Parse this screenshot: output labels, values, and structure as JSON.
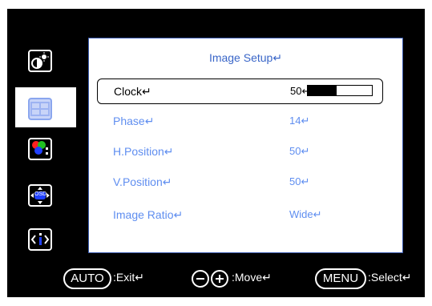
{
  "panel": {
    "title": "Image Setup↵"
  },
  "rows": [
    {
      "label": "Clock↵",
      "value": "50↵",
      "bar_fraction": 0.45
    },
    {
      "label": "Phase↵",
      "value": "14↵"
    },
    {
      "label": "H.Position↵",
      "value": "50↵"
    },
    {
      "label": "V.Position↵",
      "value": "50↵"
    },
    {
      "label": "Image Ratio↵",
      "value": "Wide↵"
    }
  ],
  "sidebar": {
    "items": [
      {
        "icon": "brightness-contrast-icon"
      },
      {
        "icon": "image-setup-icon",
        "active": true
      },
      {
        "icon": "color-icon"
      },
      {
        "icon": "osd-position-icon",
        "text": "OSD"
      },
      {
        "icon": "information-icon"
      }
    ]
  },
  "footer": {
    "auto_key": "AUTO",
    "auto_text": ":Exit↵",
    "move_text": ":Move↵",
    "menu_key": "MENU",
    "menu_text": ":Select↵"
  }
}
